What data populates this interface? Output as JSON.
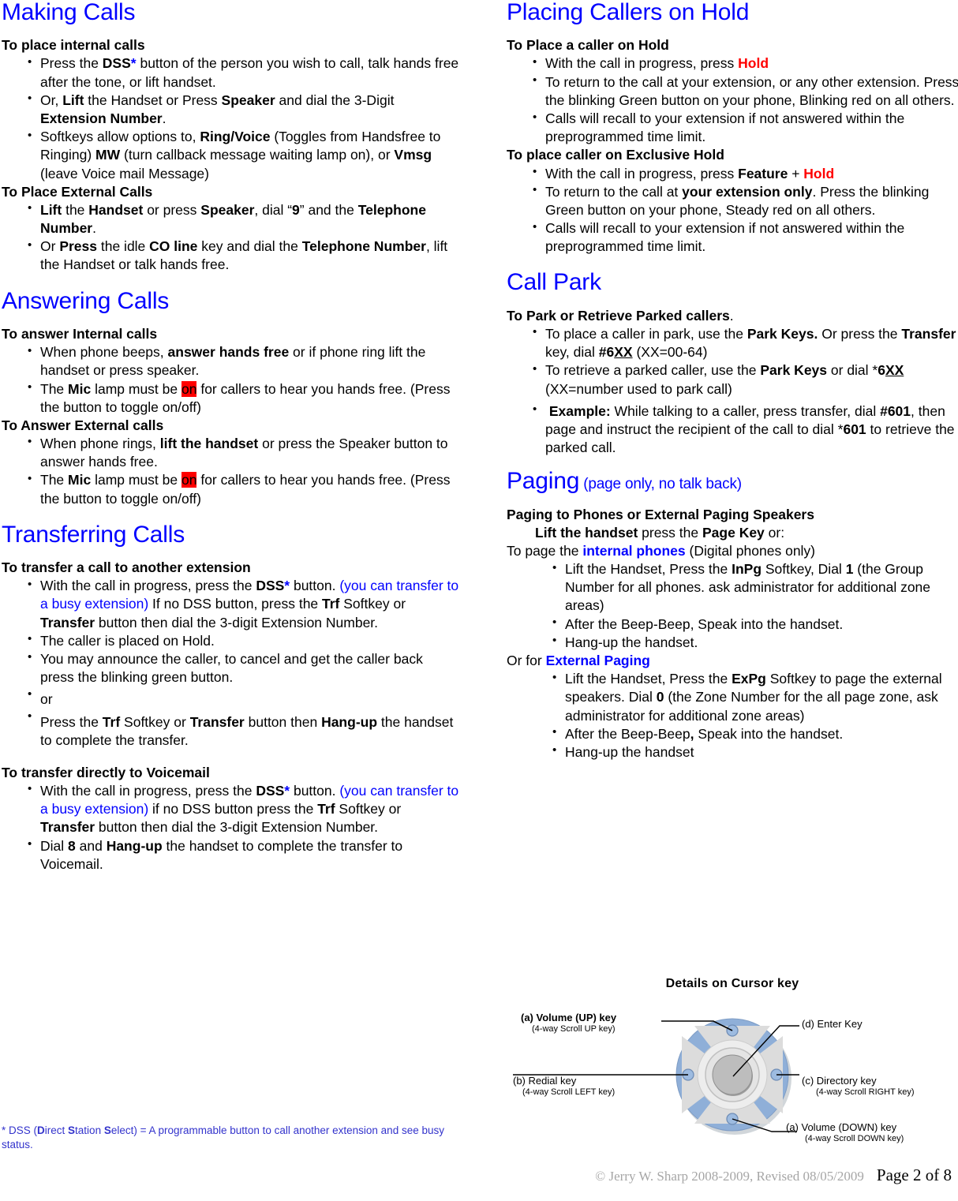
{
  "document": {
    "title": "Making Calls",
    "footer": {
      "copyright": "© Jerry W. Sharp 2008-2009,  Revised 08/05/2009",
      "page_number": "Page 2 of 8"
    },
    "footnote": {
      "prefix": "* DSS (",
      "d": "D",
      "irect": "irect ",
      "s": "S",
      "tation": "tation ",
      "s2": "S",
      "elect": "elect) = A programmable button to call another extension and see busy status."
    }
  },
  "left_column": {
    "making_calls": {
      "heading": "Making Calls",
      "internal": {
        "subhead": "To place internal calls",
        "b1_a": "Press the ",
        "b1_dss": "DSS",
        "b1_star": "*",
        "b1_b": " button of the person you wish to call, talk hands free after the tone, or lift handset.",
        "b2_a": "Or, ",
        "b2_lift": "Lift",
        "b2_b": " the Handset or Press ",
        "b2_speaker": "Speaker",
        "b2_c": " and dial the 3-Digit ",
        "b2_ext": "Extension Number",
        "b2_d": ".",
        "b3_a": "Softkeys allow options to, ",
        "b3_ring": "Ring/Voice",
        "b3_b": " (Toggles from Handsfree to Ringing) ",
        "b3_mw": "MW",
        "b3_c": " (turn callback message waiting lamp on), or ",
        "b3_vmsg": "Vmsg",
        "b3_d": " (leave Voice mail Message)"
      },
      "external": {
        "subhead": "To Place External Calls",
        "b1_lift": "Lift",
        "b1_a": " the ",
        "b1_handset": "Handset",
        "b1_b": " or press ",
        "b1_speaker": "Speaker",
        "b1_c": ", dial “",
        "b1_nine": "9",
        "b1_d": "” and the ",
        "b1_tel": "Telephone Number",
        "b1_e": ".",
        "b2_a": "Or ",
        "b2_press": "Press",
        "b2_b": " the idle ",
        "b2_co": "CO line",
        "b2_c": " key and dial the ",
        "b2_tel": "Telephone Number",
        "b2_d": ", lift the Handset or talk hands free."
      }
    },
    "answering_calls": {
      "heading": "Answering Calls",
      "internal": {
        "subhead": "To answer Internal calls",
        "b1_a": "When phone beeps, ",
        "b1_ans": "answer hands free",
        "b1_b": " or if phone ring lift the handset or press speaker.",
        "b2_a": "The ",
        "b2_mic": "Mic",
        "b2_b": " lamp must be ",
        "b2_on": "on",
        "b2_c": " for callers to hear you hands free. (Press the button to toggle on/off)"
      },
      "external": {
        "subhead": "To Answer External calls",
        "b1_a": "When phone rings, ",
        "b1_lift": "lift the handset",
        "b1_b": " or press the Speaker button to answer hands free.",
        "b2_a": "The ",
        "b2_mic": "Mic",
        "b2_b": " lamp must be ",
        "b2_on": "on",
        "b2_c": " for callers to hear you hands free. (Press the button to toggle on/off)"
      }
    },
    "transferring_calls": {
      "heading": "Transferring Calls",
      "to_extension": {
        "subhead": "To transfer a call to another extension",
        "b1_a": "With the call in progress, press the ",
        "b1_dss": "DSS",
        "b1_star": "*",
        "b1_b": " button. ",
        "b1_blue": "(you can transfer to a busy extension)",
        "b1_c": " If no DSS button, press the ",
        "b1_trf": "Trf",
        "b1_d": "  Softkey or ",
        "b1_transfer": "Transfer",
        "b1_e": " button then dial the 3-digit Extension Number.",
        "b2": "The caller is placed on Hold.",
        "b3": "You may announce the caller, to cancel and get the caller back press the blinking green button.",
        "b4": "or",
        "b5_a": "Press the ",
        "b5_trf": "Trf",
        "b5_b": "  Softkey or ",
        "b5_transfer": "Transfer",
        "b5_c": " button then ",
        "b5_hangup": "Hang-up",
        "b5_d": " the handset to complete the transfer."
      },
      "to_voicemail": {
        "subhead": "To transfer directly to Voicemail",
        "b1_a": "With the call in progress, press the ",
        "b1_dss": "DSS",
        "b1_star": "*",
        "b1_b": " button. ",
        "b1_blue": "(you can transfer to a busy extension)",
        "b1_c": " if no DSS button press the ",
        "b1_trf": "Trf",
        "b1_d": "  Softkey or ",
        "b1_transfer": "Transfer",
        "b1_e": " button then dial the 3-digit Extension Number.",
        "b2_a": "Dial ",
        "b2_eight": "8",
        "b2_b": " and ",
        "b2_hangup": "Hang-up",
        "b2_c": " the handset to complete the transfer to Voicemail."
      }
    }
  },
  "right_column": {
    "placing_on_hold": {
      "heading": "Placing Callers on Hold",
      "hold": {
        "subhead": "To Place a caller on Hold",
        "b1_a": "With the call in progress, press ",
        "b1_hold": "Hold",
        "b2": "To return to the call at your extension, or any other extension. Press the blinking Green button on your phone, Blinking red on all others.",
        "b3": "Calls will recall to your extension if not answered within the preprogrammed time limit."
      },
      "exclusive": {
        "subhead": "To place caller on Exclusive Hold",
        "b1_a": "With the call in progress, press ",
        "b1_feature": "Feature",
        "b1_plus": " + ",
        "b1_hold": "Hold",
        "b2_a": "To return to the call at ",
        "b2_ext": "your extension only",
        "b2_b": ". Press the blinking Green button on your phone, Steady red on all others.",
        "b3": "Calls will recall to your extension if not answered within the preprogrammed time limit."
      }
    },
    "call_park": {
      "heading": "Call Park",
      "subhead_a": "To Park or Retrieve Parked callers",
      "subhead_b": ".",
      "b1_a": "To place a caller in park, use the ",
      "b1_keys": "Park Keys.",
      "b1_b": " Or press the ",
      "b1_transfer": "Transfer",
      "b1_c": " key, dial ",
      "b1_code": "#6",
      "b1_code_u": "XX",
      "b1_d": "  (XX=00-64)",
      "b2_a": "To retrieve a parked caller, use the ",
      "b2_keys": "Park Keys",
      "b2_b": " or dial ",
      "b2_star": "*",
      "b2_code": "6",
      "b2_code_u": "XX",
      "b2_c": " (XX=number used to park call)",
      "b3_ex": "Example:",
      "b3_a": " While talking to a caller, press transfer, dial ",
      "b3_code": "#601",
      "b3_b": ", then page and instruct the recipient of the call to dial ",
      "b3_star": "*",
      "b3_code2": "601",
      "b3_c": " to retrieve the parked call."
    },
    "paging": {
      "heading": "Paging",
      "heading_sub": " (page only, no talk back)",
      "subhead": "Paging to Phones or External Paging Speakers",
      "line2_lift": "Lift the handset",
      "line2_a": " press the ",
      "line2_page": "Page Key",
      "line2_b": " or:",
      "internal_line_a": "To page the ",
      "internal_line_blue": "internal phones",
      "internal_line_b": " (Digital phones only)",
      "i_b1_a": "Lift the Handset, Press the ",
      "i_b1_inpg": "InPg",
      "i_b1_b": " Softkey, Dial  ",
      "i_b1_one": "1",
      "i_b1_c": " (the Group Number for all phones. ask administrator for additional zone areas)",
      "i_b2": "After the Beep-Beep, Speak into the handset.",
      "i_b3": "Hang-up the handset.",
      "external_line_a": "Or for ",
      "external_line_blue": "External Paging",
      "e_b1_a": "Lift the Handset, Press the ",
      "e_b1_expg": "ExPg",
      "e_b1_b": " Softkey to page the external speakers. Dial  ",
      "e_b1_zero": "0",
      "e_b1_c": " (the Zone Number for the all page zone, ask administrator for additional zone areas)",
      "e_b2_a": "After the Beep-Beep",
      "e_b2_comma": ",",
      "e_b2_b": " Speak into the handset.",
      "e_b3": "Hang-up the handset"
    },
    "cursor_diagram": {
      "title": "Details on Cursor key",
      "label_a_up_1": "(a) Volume (UP) key",
      "label_a_up_2": "(4-way Scroll UP key)",
      "label_b_1": "(b) Redial key",
      "label_b_2": "(4-way Scroll LEFT key)",
      "label_d_1": "(d) Enter Key",
      "label_c_1": "(c) Directory key",
      "label_c_2": "(4-way Scroll RIGHT key)",
      "label_a_dn_1": "(a) Volume (DOWN) key",
      "label_a_dn_2": "(4-way Scroll DOWN key)",
      "colors": {
        "disc": "#8FAFD8",
        "cross": "#D9D9D9",
        "ring": "#E0E0E0",
        "center": "#B8B8B8"
      }
    }
  }
}
